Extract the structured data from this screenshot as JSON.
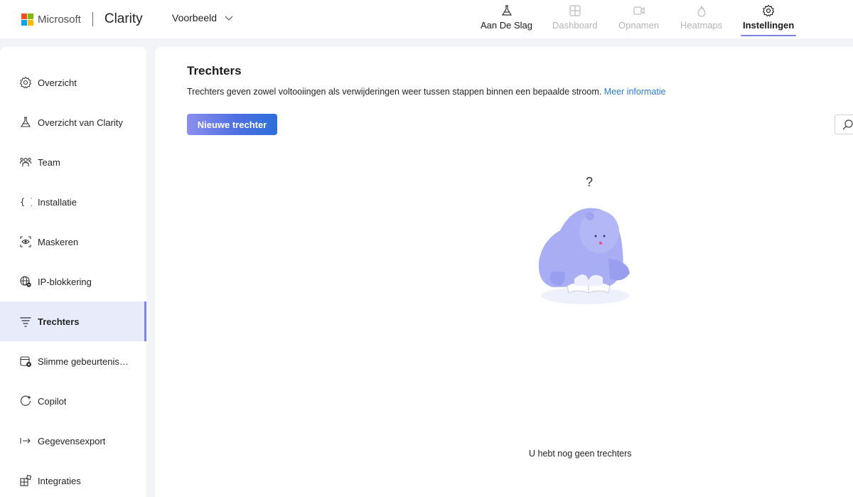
{
  "header": {
    "brand_company": "Microsoft",
    "brand_app": "Clarity",
    "project_name": "Voorbeeld",
    "nav": [
      {
        "label": "Aan De Slag",
        "icon": "flask-icon",
        "state": "normal"
      },
      {
        "label": "Dashboard",
        "icon": "dashboard-icon",
        "state": "disabled"
      },
      {
        "label": "Opnamen",
        "icon": "video-icon",
        "state": "disabled"
      },
      {
        "label": "Heatmaps",
        "icon": "flame-icon",
        "state": "disabled"
      },
      {
        "label": "Instellingen",
        "icon": "gear-icon",
        "state": "active"
      }
    ]
  },
  "sidebar": {
    "items": [
      {
        "label": "Overzicht",
        "icon": "gear-icon"
      },
      {
        "label": "Overzicht van Clarity",
        "icon": "flask-icon"
      },
      {
        "label": "Team",
        "icon": "people-icon"
      },
      {
        "label": "Installatie",
        "icon": "braces-icon"
      },
      {
        "label": "Maskeren",
        "icon": "mask-icon"
      },
      {
        "label": "IP-blokkering",
        "icon": "globe-block-icon"
      },
      {
        "label": "Trechters",
        "icon": "funnel-icon",
        "active": true
      },
      {
        "label": "Slimme gebeurtenissen",
        "icon": "calendar-gear-icon"
      },
      {
        "label": "Copilot",
        "icon": "copilot-icon"
      },
      {
        "label": "Gegevensexport",
        "icon": "export-arrow-icon"
      },
      {
        "label": "Integraties",
        "icon": "apps-icon"
      }
    ]
  },
  "main": {
    "title": "Trechters",
    "description": "Trechters geven zowel voltooiingen als verwijderingen weer tussen stappen binnen een bepaalde stroom.",
    "learn_more": "Meer informatie",
    "new_button": "Nieuwe trechter",
    "empty_question": "?",
    "empty_message": "U hebt nog geen trechters"
  },
  "colors": {
    "accent": "#7b83eb",
    "link": "#2b7cd3",
    "active_bg": "#e8ebfa",
    "bear": "#a5a8f2"
  }
}
